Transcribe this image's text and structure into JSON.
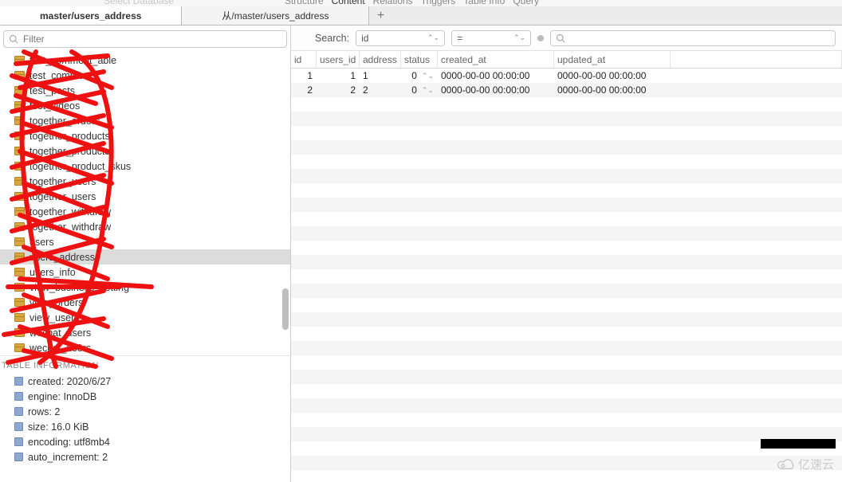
{
  "top": {
    "select_db": "Select Database",
    "menu": [
      "Structure",
      "Content",
      "Relations",
      "Triggers",
      "Table Info",
      "Query"
    ],
    "active_menu": "Content"
  },
  "tabs": [
    {
      "label": "master/users_address",
      "active": true
    },
    {
      "label": "从/master/users_address",
      "active": false
    }
  ],
  "filter_placeholder": "Filter",
  "tables": [
    "test_comment_able",
    "test_comments",
    "test_posts",
    "test_videos",
    "together_orders",
    "together_products",
    "together_products",
    "together_product_skus",
    "together_users",
    "together_users",
    "together_withdraw",
    "together_withdraw",
    "users",
    "users_address",
    "users_info",
    "view_business_setting",
    "view_orders",
    "view_users",
    "wechat_users",
    "wechat_users"
  ],
  "selected_table_index": 13,
  "table_info_title": "TABLE INFORMATION",
  "table_info": [
    "created: 2020/6/27",
    "engine: InnoDB",
    "rows: 2",
    "size: 16.0 KiB",
    "encoding: utf8mb4",
    "auto_increment: 2"
  ],
  "search": {
    "label": "Search:",
    "column": "id",
    "operator": "="
  },
  "columns": [
    "id",
    "users_id",
    "address",
    "status",
    "created_at",
    "updated_at"
  ],
  "rows": [
    {
      "id": "1",
      "users_id": "1",
      "address": "1",
      "status": "0",
      "created_at": "0000-00-00 00:00:00",
      "updated_at": "0000-00-00 00:00:00"
    },
    {
      "id": "2",
      "users_id": "2",
      "address": "2",
      "status": "0",
      "created_at": "0000-00-00 00:00:00",
      "updated_at": "0000-00-00 00:00:00"
    }
  ],
  "logo_text": "亿速云"
}
